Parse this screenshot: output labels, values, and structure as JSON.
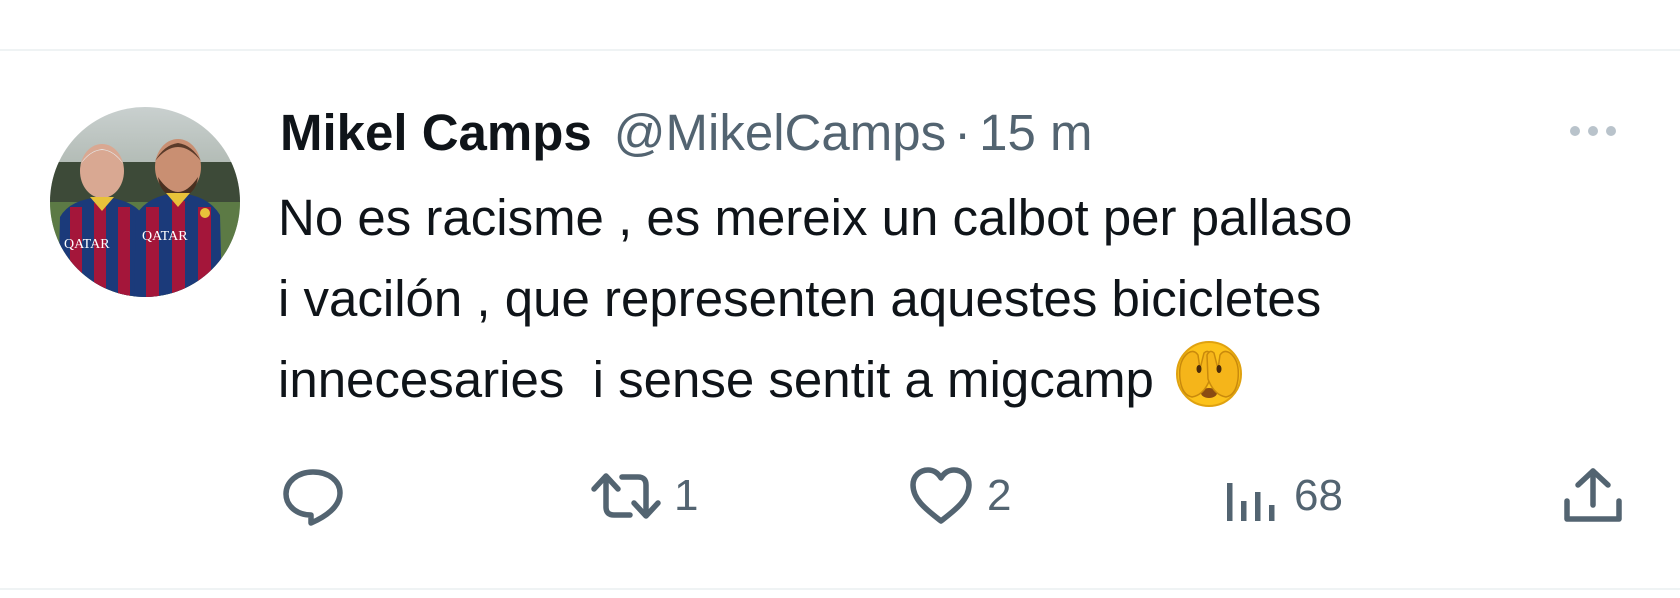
{
  "tweet": {
    "display_name": "Mikel Camps",
    "handle": "@MikelCamps",
    "separator": "·",
    "time": "15 m",
    "text_line1": "No es racisme , es mereix un calbot per pallaso",
    "text_line2": "i vacilón , que representen aquestes bicicletes",
    "text_line3": "innecesaries  i sense sentit a migcamp",
    "emoji": "face-with-peeking-eye-emoji",
    "avatar_shirt_text": "QATAR"
  },
  "actions": {
    "reply_count": "",
    "retweet_count": "1",
    "like_count": "2",
    "views_count": "68"
  },
  "icons": {
    "reply": "reply-icon",
    "retweet": "retweet-icon",
    "like": "heart-icon",
    "views": "views-icon",
    "share": "share-icon",
    "more": "more-icon"
  },
  "colors": {
    "text": "#0f1419",
    "secondary": "#536471",
    "divider": "#eff3f4",
    "barca_blue": "#1b3a7a",
    "barca_red": "#a4163a"
  }
}
